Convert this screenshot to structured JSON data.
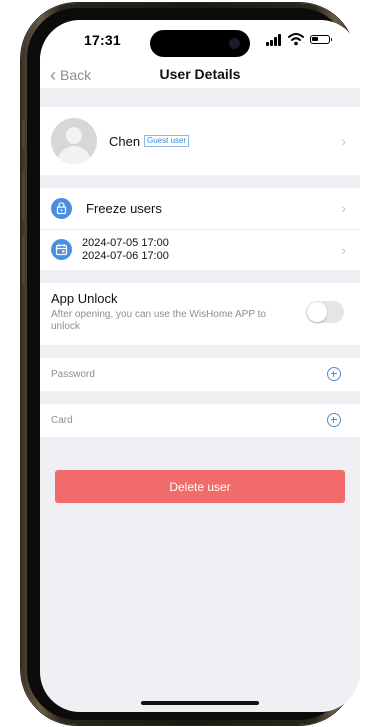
{
  "status_bar": {
    "time": "17:31"
  },
  "nav": {
    "back_label": "Back",
    "title": "User Details"
  },
  "user": {
    "name": "Chen",
    "role_badge": "Guest user"
  },
  "freeze": {
    "label": "Freeze users"
  },
  "validity": {
    "start": "2024-07-05 17:00",
    "end": "2024-07-06 17:00"
  },
  "app_unlock": {
    "title": "App Unlock",
    "description": "After opening, you can use the WisHome APP to unlock",
    "enabled": false
  },
  "credentials": {
    "password_label": "Password",
    "card_label": "Card"
  },
  "actions": {
    "delete_label": "Delete user"
  },
  "colors": {
    "accent": "#4a90e2",
    "danger": "#f06b69",
    "background": "#efeff4"
  }
}
